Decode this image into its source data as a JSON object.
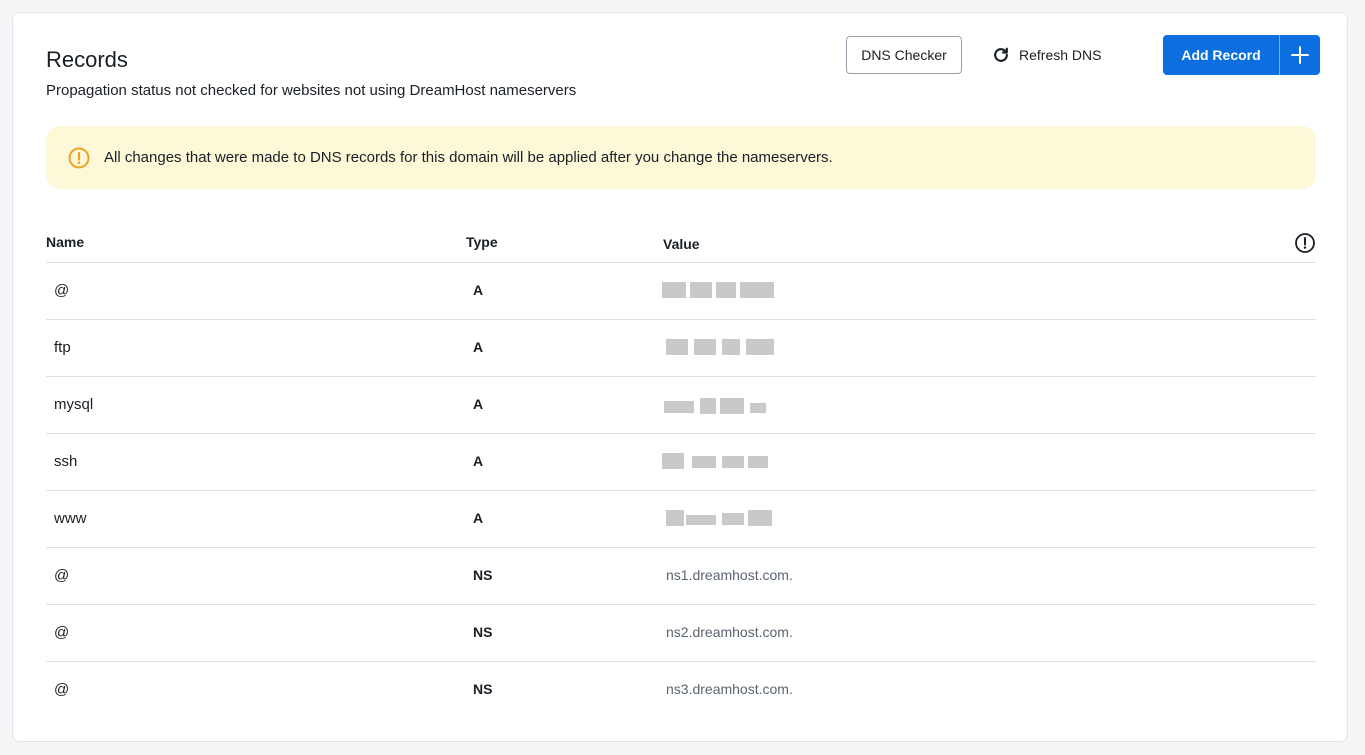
{
  "header": {
    "title": "Records",
    "subtitle": "Propagation status not checked for websites not using DreamHost nameservers",
    "dns_checker_label": "DNS Checker",
    "refresh_label": "Refresh DNS",
    "add_record_label": "Add Record"
  },
  "alert": {
    "text": "All changes that were made to DNS records for this domain will be applied after you change the nameservers."
  },
  "table": {
    "columns": [
      "Name",
      "Type",
      "Value"
    ],
    "rows": [
      {
        "name": "@",
        "type": "A",
        "value": ""
      },
      {
        "name": "ftp",
        "type": "A",
        "value": ""
      },
      {
        "name": "mysql",
        "type": "A",
        "value": ""
      },
      {
        "name": "ssh",
        "type": "A",
        "value": ""
      },
      {
        "name": "www",
        "type": "A",
        "value": ""
      },
      {
        "name": "@",
        "type": "NS",
        "value": "ns1.dreamhost.com."
      },
      {
        "name": "@",
        "type": "NS",
        "value": "ns2.dreamhost.com."
      },
      {
        "name": "@",
        "type": "NS",
        "value": "ns3.dreamhost.com."
      }
    ]
  },
  "colors": {
    "primary": "#0b6fe0",
    "alert_bg": "#fdf8d8",
    "warning_icon": "#f0a020"
  },
  "icons": {
    "refresh": "refresh-icon",
    "add": "plus-icon",
    "warning": "warning-icon",
    "info": "info-icon"
  }
}
